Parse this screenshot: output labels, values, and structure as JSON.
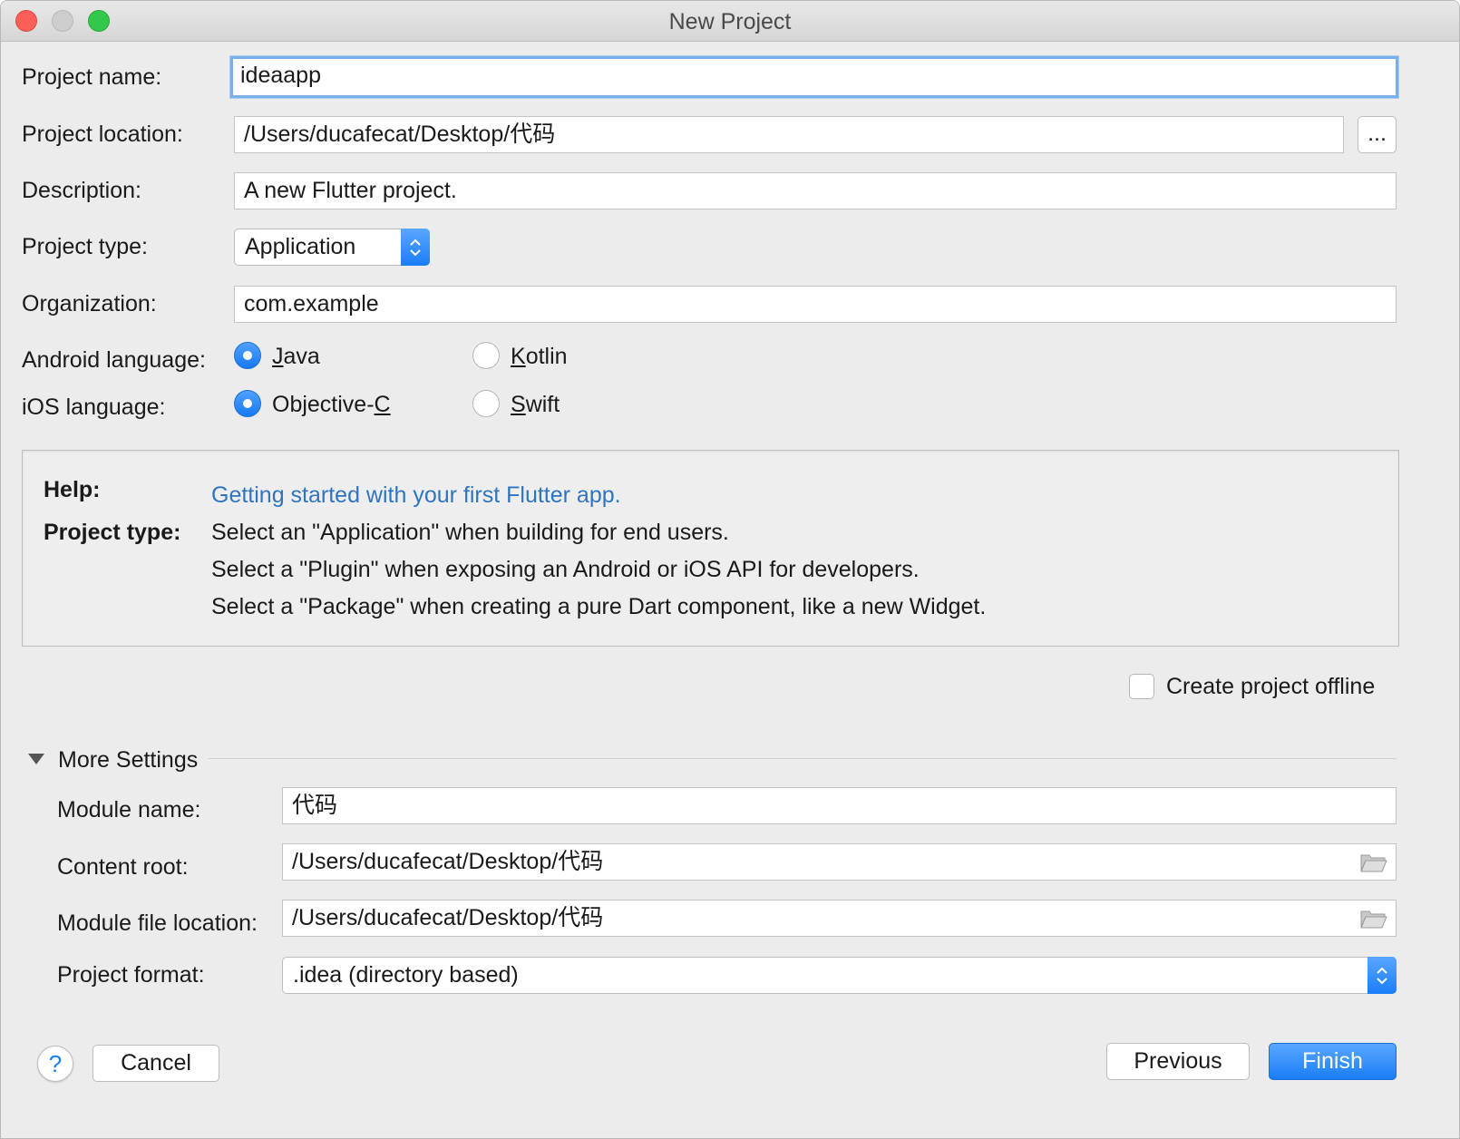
{
  "window": {
    "title": "New Project"
  },
  "form": {
    "project_name_label": "Project name:",
    "project_name_value": "ideaapp",
    "project_location_label": "Project location:",
    "project_location_value": "/Users/ducafecat/Desktop/代码",
    "browse_label": "...",
    "description_label": "Description:",
    "description_value": "A new Flutter project.",
    "project_type_label": "Project type:",
    "project_type_value": "Application",
    "organization_label": "Organization:",
    "organization_value": "com.example",
    "android_language_label": "Android language:",
    "android_options": {
      "java": "Java",
      "kotlin": "Kotlin",
      "selected": "Java"
    },
    "ios_language_label": "iOS language:",
    "ios_options": {
      "objc": "Objective-C",
      "swift": "Swift",
      "selected": "Objective-C"
    }
  },
  "help": {
    "help_label": "Help:",
    "help_link": "Getting started with your first Flutter app.",
    "project_type_label": "Project type:",
    "lines": [
      "Select an \"Application\" when building for end users.",
      "Select a \"Plugin\" when exposing an Android or iOS API for developers.",
      "Select a \"Package\" when creating a pure Dart component, like a new Widget."
    ]
  },
  "offline": {
    "label": "Create project offline",
    "checked": false
  },
  "more_settings": {
    "title": "More Settings",
    "module_name_label": "Module name:",
    "module_name_value": "代码",
    "content_root_label": "Content root:",
    "content_root_value": "/Users/ducafecat/Desktop/代码",
    "module_file_location_label": "Module file location:",
    "module_file_location_value": "/Users/ducafecat/Desktop/代码",
    "project_format_label": "Project format:",
    "project_format_value": ".idea (directory based)"
  },
  "footer": {
    "help_icon": "?",
    "cancel": "Cancel",
    "previous": "Previous",
    "finish": "Finish"
  },
  "colors": {
    "accent": "#1a7ef6",
    "link": "#2f74c0",
    "close": "#fc5f57",
    "zoom": "#34c84a"
  },
  "icons": [
    "folder-icon",
    "chevron-updown-icon",
    "disclosure-triangle-icon",
    "help-icon"
  ]
}
